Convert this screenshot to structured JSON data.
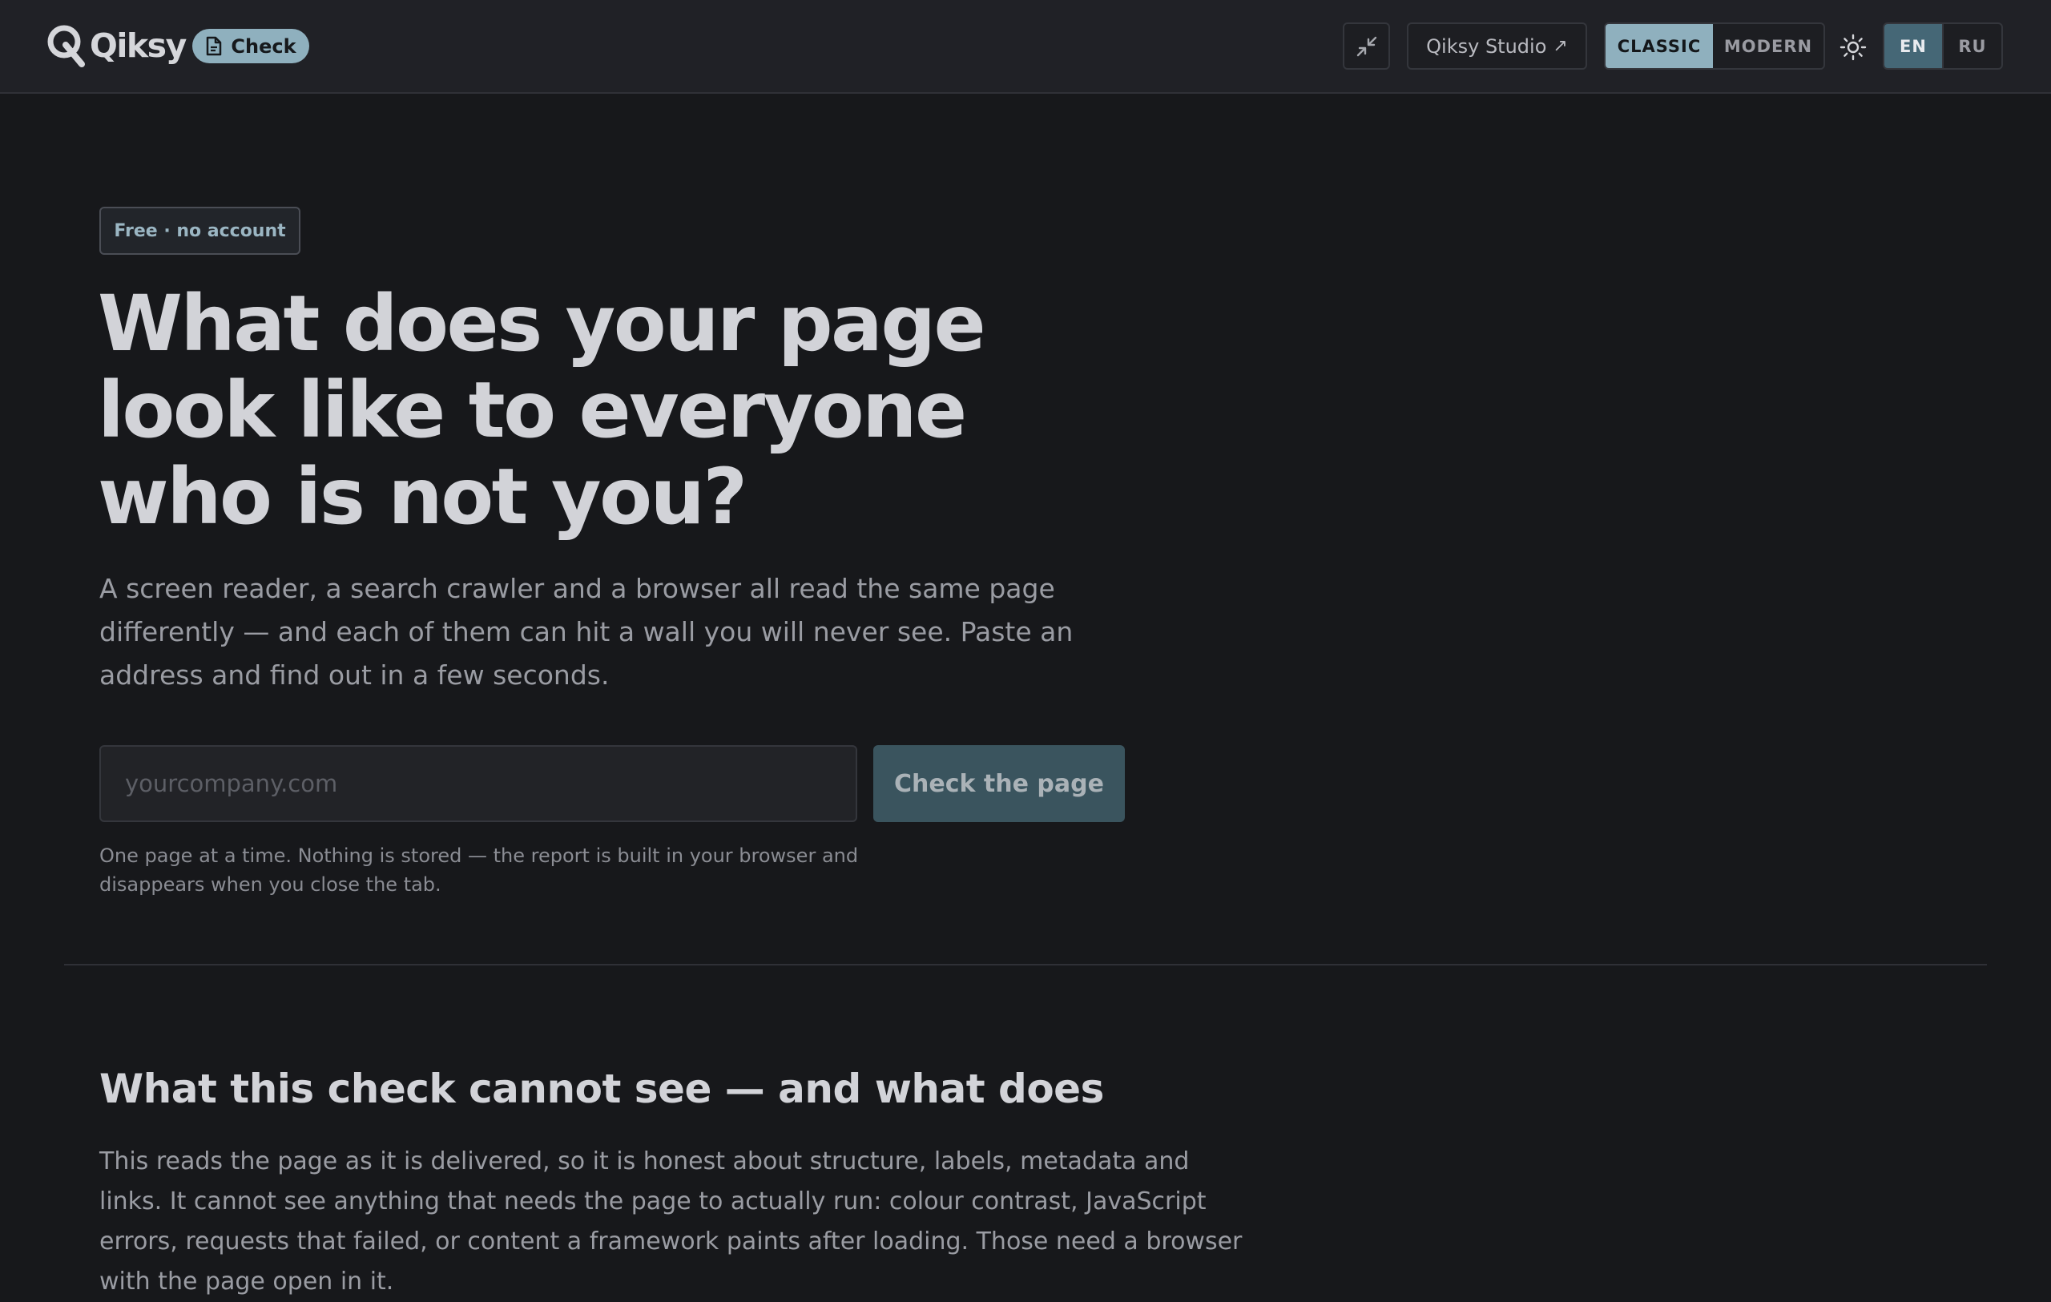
{
  "header": {
    "logo_text": "Qiksy",
    "product_badge": "Check",
    "studio_link": "Qiksy Studio",
    "studio_arrow": "↗",
    "style_options": [
      "CLASSIC",
      "MODERN"
    ],
    "style_selected": "CLASSIC",
    "language_options": [
      "EN",
      "RU"
    ],
    "language_selected": "EN"
  },
  "hero": {
    "pill": "Free · no account",
    "title": "What does your page look like to everyone who is not you?",
    "lead": "A screen reader, a search crawler and a browser all read the same page differently — and each of them can hit a wall you will never see. Paste an address and find out in a few seconds.",
    "input_placeholder": "yourcompany.com",
    "input_value": "",
    "button_label": "Check the page",
    "note": "One page at a time. Nothing is stored — the report is built in your browser and disappears when you close the tab."
  },
  "section": {
    "title": "What this check cannot see — and what does",
    "text": "This reads the page as it is delivered, so it is honest about structure, labels, metadata and links. It cannot see anything that needs the page to actually run: colour contrast, JavaScript errors, requests that failed, or content a framework paints after loading. Those need a browser with the page open in it."
  },
  "colors": {
    "background": "#17181b",
    "header": "#202126",
    "accent": "#8fb0be",
    "button": "#3a545e"
  },
  "icons": [
    "qiksy-logo-icon",
    "document-icon",
    "collapse-icon",
    "sun-icon"
  ]
}
